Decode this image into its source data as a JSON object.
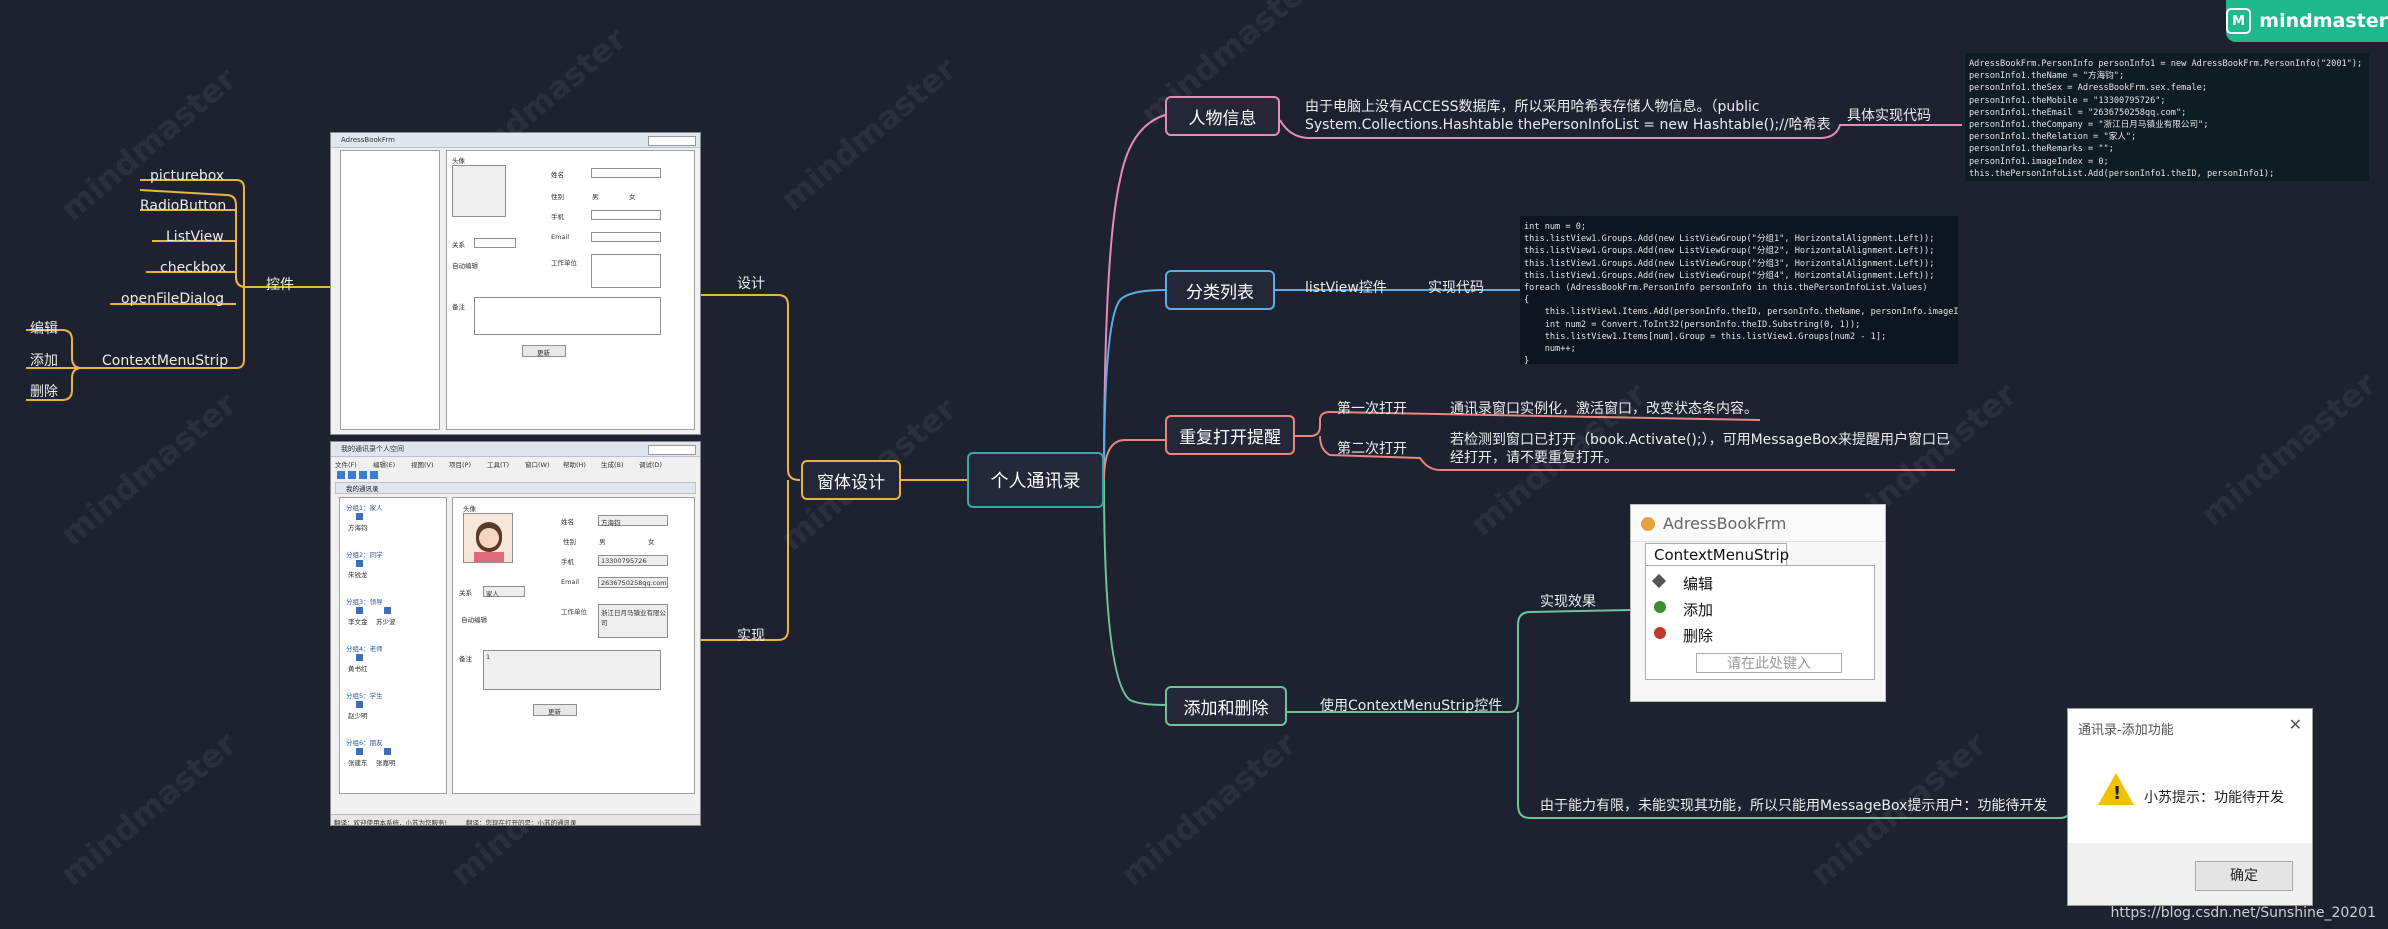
{
  "brand": {
    "name": "mindmaster"
  },
  "watermark": "mindmaster",
  "root": "个人通讯录",
  "branches": {
    "window_design": {
      "label": "窗体设计",
      "design": "设计",
      "implement": "实现",
      "controls": {
        "label": "控件",
        "items": [
          "picturebox",
          "RadioButton",
          "ListView",
          "checkbox",
          "openFileDialog",
          "ContextMenuStrip"
        ],
        "context_items": [
          "编辑",
          "添加",
          "删除"
        ]
      }
    },
    "person_info": {
      "label": "人物信息",
      "desc_line1": "由于电脑上没有ACCESS数据库，所以采用哈希表存储人物信息。（public",
      "desc_line2": "System.Collections.Hashtable thePersonInfoList = new Hashtable();//哈希表",
      "impl": "具体实现代码"
    },
    "category": {
      "label": "分类列表",
      "control": "listView控件",
      "impl": "实现代码"
    },
    "reopen": {
      "label": "重复打开提醒",
      "first": "第一次打开",
      "first_desc": "通讯录窗口实例化，激活窗口，改变状态条内容。",
      "second": "第二次打开",
      "second_desc_line1": "若检测到窗口已打开（book.Activate();），可用MessageBox来提醒用户窗口已",
      "second_desc_line2": "经打开，请不要重复打开。"
    },
    "add_delete": {
      "label": "添加和删除",
      "use": "使用ContextMenuStrip控件",
      "effect": "实现效果",
      "limit": "由于能力有限，未能实现其功能，所以只能用MessageBox提示用户：功能待开发"
    }
  },
  "code_person": [
    "AdressBookFrm.PersonInfo personInfo1 = new AdressBookFrm.PersonInfo(\"2001\");",
    "personInfo1.theName = \"方海钧\";",
    "personInfo1.theSex = AdressBookFrm.sex.female;",
    "personInfo1.theMobile = \"13300795726\";",
    "personInfo1.theEmail = \"2636750258qq.com\";",
    "personInfo1.theCompany = \"浙江日月马镇业有限公司\";",
    "personInfo1.theRelation = \"家人\";",
    "personInfo1.theRemarks = \"\";",
    "personInfo1.imageIndex = 0;",
    "this.thePersonInfoList.Add(personInfo1.theID, personInfo1);"
  ],
  "code_list": [
    "int num = 0;",
    "this.listView1.Groups.Add(new ListViewGroup(\"分组1\", HorizontalAlignment.Left));",
    "this.listView1.Groups.Add(new ListViewGroup(\"分组2\", HorizontalAlignment.Left));",
    "this.listView1.Groups.Add(new ListViewGroup(\"分组3\", HorizontalAlignment.Left));",
    "this.listView1.Groups.Add(new ListViewGroup(\"分组4\", HorizontalAlignment.Left));",
    "foreach (AdressBookFrm.PersonInfo personInfo in this.thePersonInfoList.Values)",
    "{",
    "    this.listView1.Items.Add(personInfo.theID, personInfo.theName, personInfo.imageIndex);",
    "    int num2 = Convert.ToInt32(personInfo.theID.Substring(0, 1));",
    "    this.listView1.Items[num].Group = this.listView1.Groups[num2 - 1];",
    "    num++;",
    "}"
  ],
  "design_form": {
    "title": "AdressBookFrm",
    "photo": "头像",
    "name": "姓名",
    "sex": "性别",
    "male": "男",
    "female": "女",
    "mobile": "手机",
    "email": "Email",
    "relation": "关系",
    "autostart": "自动编辑",
    "company": "工作单位",
    "remarks": "备注",
    "update": "更新"
  },
  "impl_form": {
    "title": "我的通讯录个人空间",
    "menu": [
      "文件(F)",
      "编辑(E)",
      "视图(V)",
      "项目(P)",
      "工具(T)",
      "窗口(W)",
      "帮助(H)",
      "生成(B)",
      "调试(D)"
    ],
    "child_title": "我的通讯录",
    "groups": [
      {
        "name": "分组1：家人",
        "members": [
          "方海钧"
        ]
      },
      {
        "name": "分组2：同学",
        "members": [
          "朱锐龙"
        ]
      },
      {
        "name": "分组3：领导",
        "members": [
          "李文金",
          "苏少波"
        ]
      },
      {
        "name": "分组4：老师",
        "members": [
          "黄书红"
        ]
      },
      {
        "name": "分组5：学生",
        "members": [
          "赵少明"
        ]
      },
      {
        "name": "分组6：朋友",
        "members": [
          "张建东",
          "张嘉明"
        ]
      }
    ],
    "photo": "头像",
    "name_label": "姓名",
    "name_value": "方海钧",
    "sex": "性别",
    "male": "男",
    "female": "女",
    "mobile_label": "手机",
    "mobile_value": "13300795726",
    "email_label": "Email",
    "email_value": "2636750258qq.com",
    "relation_label": "关系",
    "relation_value": "家人",
    "autostart": "自动编辑",
    "company_label": "工作单位",
    "company_value": "浙江日月马镇业有限公司",
    "remarks_label": "备注",
    "remarks_value": "1",
    "update": "更新",
    "status_left": "翻译：欢迎使用本系统，小苏为您服务!",
    "status_right": "翻译：您现在打开的是：小苏的通讯录"
  },
  "context_menu": {
    "title": "AdressBookFrm",
    "tab": "ContextMenuStrip",
    "items": [
      "编辑",
      "添加",
      "删除"
    ],
    "placeholder": "请在此处键入"
  },
  "dialog": {
    "title": "通讯录-添加功能",
    "message": "小苏提示：功能待开发",
    "ok": "确定"
  },
  "footer": "https://blog.csdn.net/Sunshine_20201"
}
